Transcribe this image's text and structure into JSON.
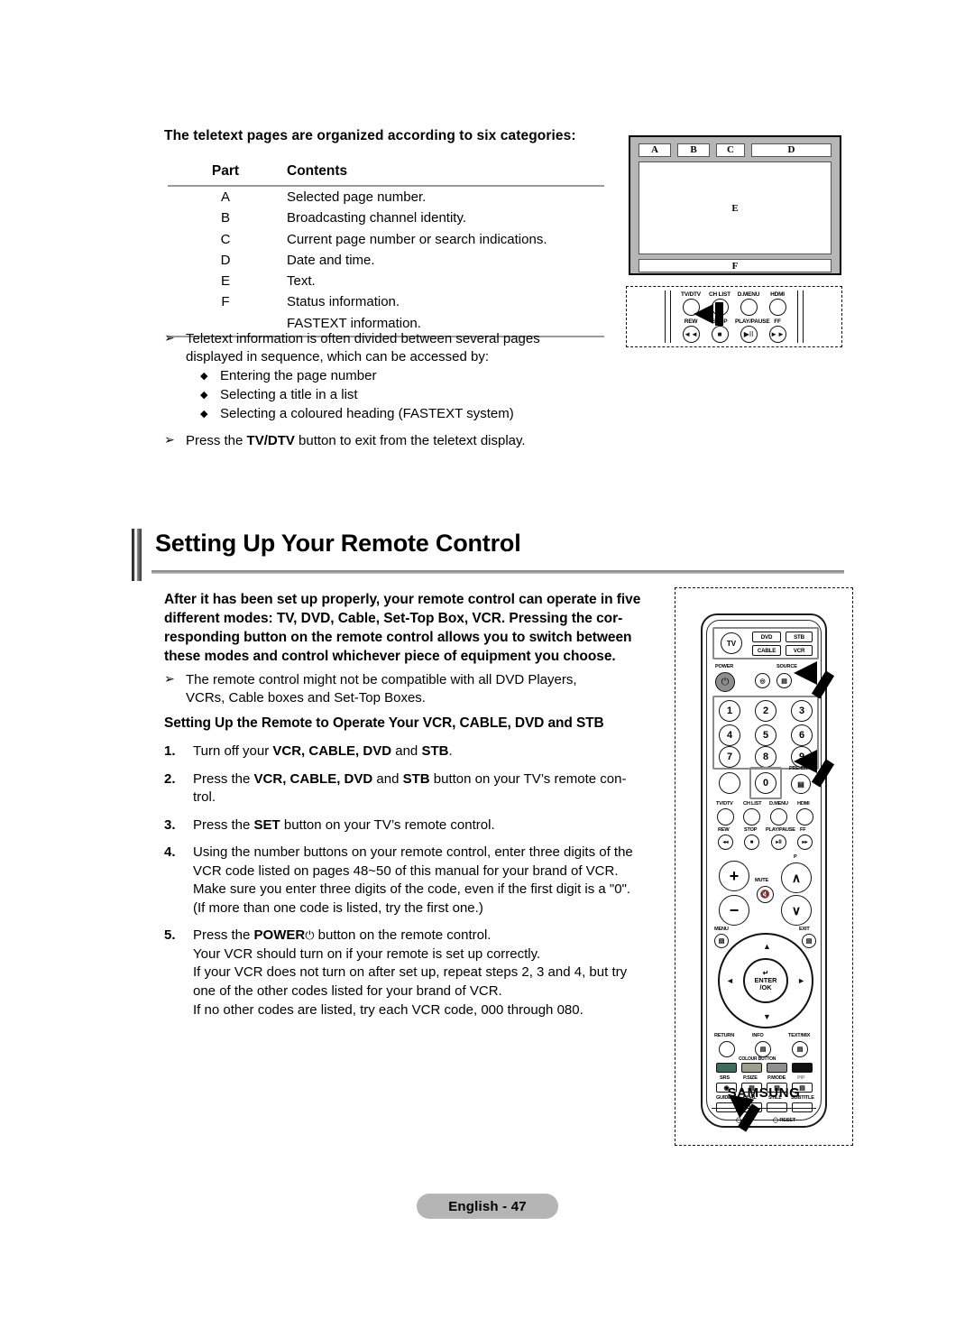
{
  "top_section": {
    "intro": "The teletext pages are organized according to six categories:",
    "table": {
      "headers": [
        "Part",
        "Contents"
      ],
      "rows": [
        {
          "part": "A",
          "contents": "Selected page number."
        },
        {
          "part": "B",
          "contents": "Broadcasting channel identity."
        },
        {
          "part": "C",
          "contents": "Current page number or search indications."
        },
        {
          "part": "D",
          "contents": "Date and time."
        },
        {
          "part": "E",
          "contents": "Text."
        },
        {
          "part": "F",
          "contents": "Status information."
        }
      ],
      "extra_row": "FASTEXT information."
    },
    "bullets": {
      "marker": "➢",
      "sub_marker": "◆",
      "item1_line1": "Teletext information is often divided between several pages",
      "item1_line2": "displayed in sequence, which can be accessed by:",
      "sub_items": [
        "Entering the page number",
        "Selecting a title in a list",
        "Selecting a coloured heading (FASTEXT system)"
      ],
      "item2_pre": "Press the ",
      "item2_bold": "TV/DTV",
      "item2_post": " button to exit from the teletext display."
    }
  },
  "teletext_diagram": {
    "a": "A",
    "b": "B",
    "c": "C",
    "d": "D",
    "e": "E",
    "f": "F"
  },
  "remote_callout_top": {
    "row1": [
      {
        "label": "TV/DTV",
        "glyph": ""
      },
      {
        "label": "CH LIST",
        "glyph": ""
      },
      {
        "label": "D.MENU",
        "glyph": ""
      },
      {
        "label": "HDMI",
        "glyph": ""
      }
    ],
    "row2": [
      {
        "label": "REW",
        "glyph": "◄◄"
      },
      {
        "label": "STOP",
        "glyph": "■"
      },
      {
        "label": "PLAY/PAUSE",
        "glyph": "▶II"
      },
      {
        "label": "FF",
        "glyph": "►►"
      }
    ]
  },
  "heading": {
    "title": "Setting Up Your Remote Control"
  },
  "body": {
    "intro_line1": "After it has been set up properly, your remote control can operate in five",
    "intro_line2": "different modes: TV, DVD, Cable, Set-Top Box, VCR. Pressing the cor-",
    "intro_line3": "responding button on the remote control allows you to switch between",
    "intro_line4": "these modes and control whichever piece of equipment you choose.",
    "note_marker": "➢",
    "note_line1": "The remote control might not be compatible with all DVD Players,",
    "note_line2": "VCRs, Cable boxes and Set-Top Boxes.",
    "subheading": "Setting Up the Remote to Operate Your VCR, CABLE, DVD and STB",
    "steps": [
      {
        "num": "1.",
        "lines": [
          {
            "parts": [
              {
                "t": "Turn off your ",
                "b": false
              },
              {
                "t": "VCR, CABLE, DVD",
                "b": true
              },
              {
                "t": " and ",
                "b": false
              },
              {
                "t": "STB",
                "b": true
              },
              {
                "t": ".",
                "b": false
              }
            ]
          }
        ]
      },
      {
        "num": "2.",
        "lines": [
          {
            "parts": [
              {
                "t": "Press the ",
                "b": false
              },
              {
                "t": "VCR, CABLE, DVD",
                "b": true
              },
              {
                "t": " and ",
                "b": false
              },
              {
                "t": "STB",
                "b": true
              },
              {
                "t": " button on your TV’s remote con-",
                "b": false
              }
            ]
          },
          {
            "parts": [
              {
                "t": "trol.",
                "b": false
              }
            ]
          }
        ]
      },
      {
        "num": "3.",
        "lines": [
          {
            "parts": [
              {
                "t": "Press the ",
                "b": false
              },
              {
                "t": "SET",
                "b": true
              },
              {
                "t": " button on your TV’s remote control.",
                "b": false
              }
            ]
          }
        ]
      },
      {
        "num": "4.",
        "lines": [
          {
            "parts": [
              {
                "t": "Using the number buttons on your remote control, enter three digits of the",
                "b": false
              }
            ]
          },
          {
            "parts": [
              {
                "t": "VCR code listed on pages 48~50 of this manual for your brand of VCR.",
                "b": false
              }
            ]
          },
          {
            "parts": [
              {
                "t": "Make sure you enter three digits of the code, even if the first digit is a \"0\".",
                "b": false
              }
            ]
          },
          {
            "parts": [
              {
                "t": "(If more than one code is listed, try the first one.)",
                "b": false
              }
            ]
          }
        ]
      },
      {
        "num": "5.",
        "lines": [
          {
            "parts": [
              {
                "t": "Press the ",
                "b": false
              },
              {
                "t": "POWER",
                "b": true
              },
              {
                "t": "⏻",
                "b": false
              },
              {
                "t": " button on the remote control.",
                "b": false
              }
            ]
          },
          {
            "parts": [
              {
                "t": "Your VCR should turn on if your remote is set up correctly.",
                "b": false
              }
            ]
          },
          {
            "parts": [
              {
                "t": "If your VCR does not turn on after set up, repeat steps 2, 3 and 4, but try",
                "b": false
              }
            ]
          },
          {
            "parts": [
              {
                "t": "one of the other codes listed for your brand of VCR.",
                "b": false
              }
            ]
          },
          {
            "parts": [
              {
                "t": "If no other codes are listed, try each VCR code, 000 through 080.",
                "b": false
              }
            ]
          }
        ]
      }
    ]
  },
  "remote": {
    "mode_buttons": {
      "tv": "TV",
      "dvd": "DVD",
      "stb": "STB",
      "cable": "CABLE",
      "vcr": "VCR"
    },
    "power_label": "POWER",
    "power_glyph": "⏻",
    "source_label": "SOURCE",
    "numbers": [
      "1",
      "2",
      "3",
      "4",
      "5",
      "6",
      "7",
      "8",
      "9",
      "0"
    ],
    "prech_label": "PRE-CH",
    "media_row1": [
      "TV/DTV",
      "CH LIST",
      "D.MENU",
      "HDMI"
    ],
    "media_row2": [
      "REW",
      "STOP",
      "PLAY/PAUSE",
      "FF"
    ],
    "volume_plus": "+",
    "volume_minus": "−",
    "mute_label": "MUTE",
    "channel_label": "P",
    "channel_up": "∧",
    "channel_down": "∨",
    "menu_label": "MENU",
    "exit_label": "EXIT",
    "enter_label_1": "ENTER",
    "enter_label_2": "/OK",
    "nav_up": "▲",
    "nav_down": "▼",
    "nav_left": "◄",
    "nav_right": "►",
    "return_label": "RETURN",
    "info_label": "INFO",
    "textmix_label": "TEXT/MIX",
    "colour_buttons_label": "COLOUR BUTTON",
    "colour_swatches": [
      "#3d6b5c",
      "#9aa08c",
      "#8f8f8f",
      "#111111"
    ],
    "feature_row1": [
      "SRS",
      "P.SIZE",
      "P.MODE",
      "PIP"
    ],
    "feature_row2": [
      "GUIDE",
      "DUAL",
      "STILL",
      "SUBTITLE"
    ],
    "set_label": "SET",
    "reset_label": "RESET",
    "brand": "SAMSUNG"
  },
  "footer": {
    "page_label": "English - 47"
  }
}
